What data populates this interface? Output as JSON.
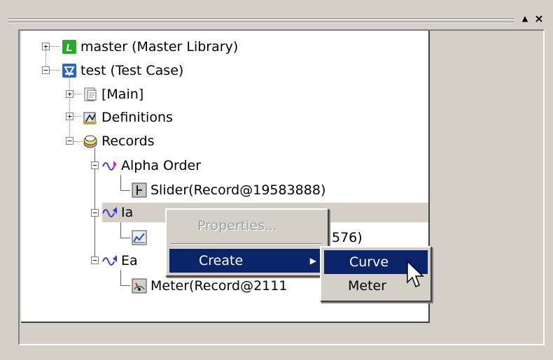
{
  "window": {
    "pin_button": "▲",
    "close_button": "×"
  },
  "tree": {
    "master": "master (Master Library)",
    "test": "test (Test Case)",
    "main": "[Main]",
    "definitions": "Definitions",
    "records": "Records",
    "alpha_order": "Alpha Order",
    "slider": "Slider(Record@19583888)",
    "ia": "Ia",
    "curve_record_suffix": "576)",
    "ea": "Ea",
    "meter_record": "Meter(Record@2111"
  },
  "context_menu": {
    "properties": "Properties...",
    "create": "Create",
    "submenu_arrow": "▶"
  },
  "submenu": {
    "curve": "Curve",
    "meter": "Meter"
  },
  "colors": {
    "selection": "#0a246a",
    "library_icon": "#2aa830",
    "test_icon": "#2a62d8",
    "wave": "#3a3ad0",
    "marker": "#e020c0"
  },
  "icons": {
    "master": "library-icon",
    "test": "test-case-icon",
    "main": "document-icon",
    "definitions": "definitions-icon",
    "records": "records-icon",
    "record_group": "waveform-icon",
    "slider": "slider-icon",
    "curve": "curve-icon",
    "meter": "meter-icon"
  }
}
